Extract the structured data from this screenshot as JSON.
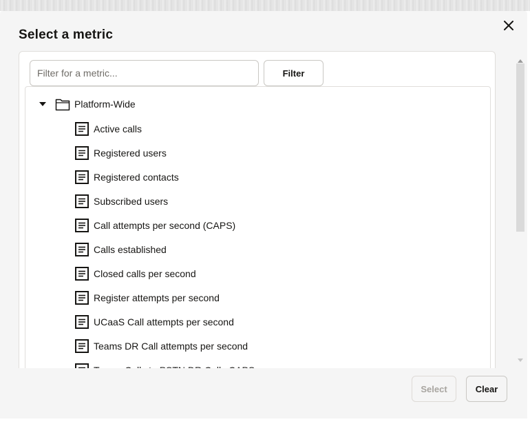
{
  "dialog": {
    "title": "Select a metric",
    "close_icon": "close-icon"
  },
  "filter": {
    "placeholder": "Filter for a metric...",
    "value": "",
    "button_label": "Filter"
  },
  "tree": {
    "root": {
      "label": "Platform-Wide",
      "expanded": true,
      "icon": "folder-icon"
    },
    "items": [
      {
        "label": "Active calls",
        "icon": "document-icon"
      },
      {
        "label": "Registered users",
        "icon": "document-icon"
      },
      {
        "label": "Registered contacts",
        "icon": "document-icon"
      },
      {
        "label": "Subscribed users",
        "icon": "document-icon"
      },
      {
        "label": "Call attempts per second (CAPS)",
        "icon": "document-icon"
      },
      {
        "label": "Calls established",
        "icon": "document-icon"
      },
      {
        "label": "Closed calls per second",
        "icon": "document-icon"
      },
      {
        "label": "Register attempts per second",
        "icon": "document-icon"
      },
      {
        "label": "UCaaS Call attempts per second",
        "icon": "document-icon"
      },
      {
        "label": "Teams DR Call attempts per second",
        "icon": "document-icon"
      },
      {
        "label": "Teams Calls to PSTN DR Calls CAPS",
        "icon": "document-icon"
      }
    ]
  },
  "footer": {
    "select_label": "Select",
    "select_disabled": true,
    "clear_label": "Clear"
  },
  "colors": {
    "dialog_bg": "#f5f5f5",
    "text": "#161513",
    "border": "#c9c7c3",
    "disabled_text": "#a8a5a0"
  }
}
